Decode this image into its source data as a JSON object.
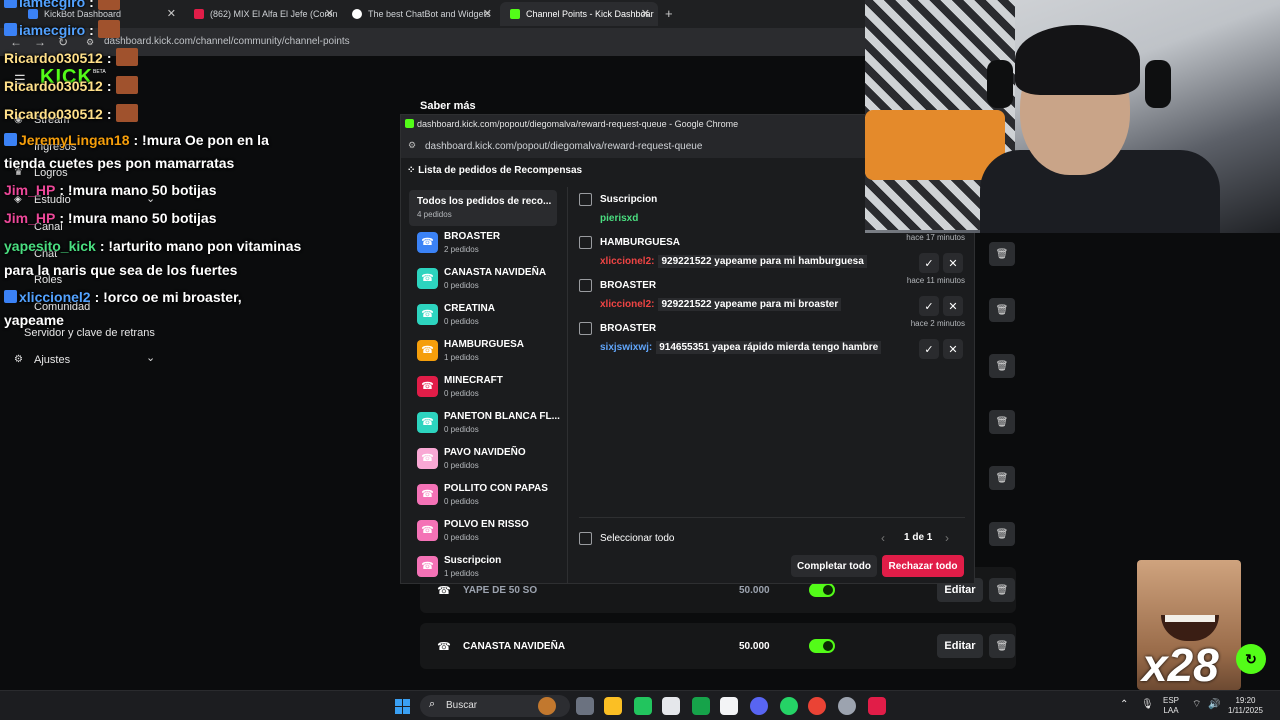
{
  "browser": {
    "tabs": [
      {
        "label": "KickBot Dashboard"
      },
      {
        "label": "(862) MIX El Alfa El Jefe (Coron"
      },
      {
        "label": "The best ChatBot and Widgets"
      },
      {
        "label": "Channel Points - Kick Dashboar"
      }
    ],
    "url": "dashboard.kick.com/channel/community/channel-points"
  },
  "sidebar": {
    "logo": "KICK",
    "beta": "BETA",
    "items": [
      {
        "label": "Stream"
      },
      {
        "label": "Ingresos"
      },
      {
        "label": "Logros"
      },
      {
        "label": "Estudio"
      },
      {
        "label": "Canal"
      },
      {
        "label": "Chat"
      },
      {
        "label": "Roles"
      },
      {
        "label": "Comunidad"
      },
      {
        "label": "Servidor y clave de retrans"
      },
      {
        "label": "Ajustes"
      }
    ]
  },
  "main": {
    "saber_mas": "Saber más",
    "rewards": [
      {
        "name": "YAPE DE 50 SO",
        "cost": "50.000",
        "edit": "Editar",
        "color": "#e11d48"
      },
      {
        "name": "CANASTA NAVIDEÑA",
        "cost": "50.000",
        "edit": "Editar",
        "color": "#2dd4bf"
      }
    ]
  },
  "chat": [
    {
      "user": "iamecgiro",
      "text": ":",
      "color": "#53a2ff"
    },
    {
      "user": "iamecgiro",
      "text": ":",
      "color": "#53a2ff"
    },
    {
      "user": "Ricardo030512",
      "text": ":",
      "color": "#ffe08a"
    },
    {
      "user": "Ricardo030512",
      "text": ":",
      "color": "#ffe08a"
    },
    {
      "user": "Ricardo030512",
      "text": ":",
      "color": "#ffe08a"
    },
    {
      "user": "JeremyLingan18",
      "text": ": !mura Oe pon en la",
      "color": "#f59e0b"
    },
    {
      "user": "",
      "text": "tienda cuetes pes pon mamarratas",
      "color": "#ffffff"
    },
    {
      "user": "Jim_HP",
      "text": ": !mura mano 50 botijas",
      "color": "#ec4899"
    },
    {
      "user": "Jim_HP",
      "text": ": !mura mano 50 botijas",
      "color": "#ec4899"
    },
    {
      "user": "yapesito_kick",
      "text": ": !arturito mano pon vitaminas",
      "color": "#4ade80"
    },
    {
      "user": "",
      "text": "para la naris que sea de los fuertes",
      "color": "#ffffff"
    },
    {
      "user": "xliccionel2",
      "text": ": !orco oe mi broaster,",
      "color": "#53a2ff"
    },
    {
      "user": "",
      "text": "yapeame",
      "color": "#ffffff"
    }
  ],
  "popup": {
    "window_title": "dashboard.kick.com/popout/diegomalva/reward-request-queue - Google Chrome",
    "url": "dashboard.kick.com/popout/diegomalva/reward-request-queue",
    "heading": "Lista de pedidos de Recompensas",
    "all": {
      "label": "Todos los pedidos de reco...",
      "count": "4 pedidos"
    },
    "rewards": [
      {
        "name": "BROASTER",
        "count": "2 pedidos",
        "color": "#3b82f6"
      },
      {
        "name": "CANASTA NAVIDEÑA",
        "count": "0 pedidos",
        "color": "#2dd4bf"
      },
      {
        "name": "CREATINA",
        "count": "0 pedidos",
        "color": "#2dd4bf"
      },
      {
        "name": "HAMBURGUESA",
        "count": "1 pedidos",
        "color": "#f59e0b"
      },
      {
        "name": "MINECRAFT",
        "count": "0 pedidos",
        "color": "#e11d48"
      },
      {
        "name": "PANETON BLANCA FL...",
        "count": "0 pedidos",
        "color": "#2dd4bf"
      },
      {
        "name": "PAVO NAVIDEÑO",
        "count": "0 pedidos",
        "color": "#f9a8d4"
      },
      {
        "name": "POLLITO CON PAPAS",
        "count": "0 pedidos",
        "color": "#f472b6"
      },
      {
        "name": "POLVO EN RISSO",
        "count": "0 pedidos",
        "color": "#f472b6"
      },
      {
        "name": "Suscripcion",
        "count": "1 pedidos",
        "color": "#f472b6"
      }
    ],
    "requests": [
      {
        "reward": "Suscripcion",
        "user": "pierisxd",
        "message": "",
        "time": "",
        "user_color": "#4ade80"
      },
      {
        "reward": "HAMBURGUESA",
        "user": "xliccionel2:",
        "message": "929221522 yapeame para mi hamburguesa",
        "time": "hace 17 minutos",
        "user_color": "#ef4444"
      },
      {
        "reward": "BROASTER",
        "user": "xliccionel2:",
        "message": "929221522 yapeame para mi broaster",
        "time": "hace 11 minutos",
        "user_color": "#ef4444"
      },
      {
        "reward": "BROASTER",
        "user": "sixjswixwj:",
        "message": "914655351 yapea rápido mierda tengo hambre",
        "time": "hace 2 minutos",
        "user_color": "#60a5fa"
      }
    ],
    "select_all": "Seleccionar todo",
    "pager": "1 de 1",
    "complete_all": "Completar todo",
    "reject_all": "Rechazar todo"
  },
  "overlay": {
    "counter": "x28"
  },
  "taskbar": {
    "search": "Buscar",
    "lang1": "ESP",
    "lang2": "LAA",
    "time": "19:20",
    "date": "1/11/2025"
  }
}
